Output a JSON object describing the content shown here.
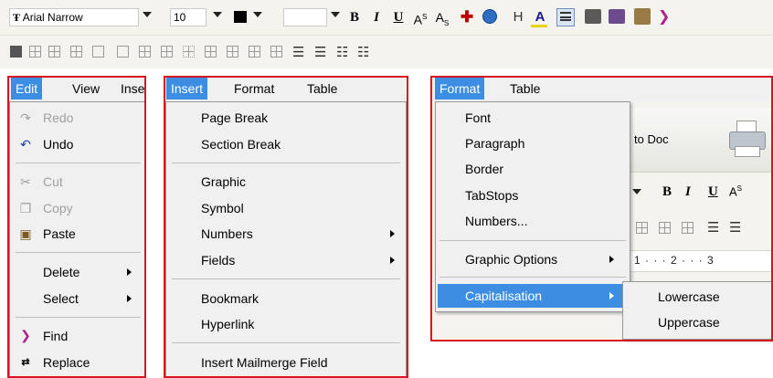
{
  "toolbar": {
    "font_name": "Arial Narrow",
    "font_size": "10",
    "format_buttons": [
      "B",
      "I",
      "U",
      "A",
      "A",
      "H",
      "A"
    ],
    "superscript_mark": "S",
    "subscript_mark": "S"
  },
  "panel_edit": {
    "menubar": [
      "Edit",
      "View",
      "Inse"
    ],
    "items": {
      "redo": "Redo",
      "undo": "Undo",
      "cut": "Cut",
      "copy": "Copy",
      "paste": "Paste",
      "delete": "Delete",
      "select": "Select",
      "find": "Find",
      "replace": "Replace"
    }
  },
  "panel_insert": {
    "menubar": [
      "Insert",
      "Format",
      "Table"
    ],
    "items": [
      "Page Break",
      "Section Break",
      "Graphic",
      "Symbol",
      "Numbers",
      "Fields",
      "Bookmark",
      "Hyperlink",
      "Insert Mailmerge Field"
    ]
  },
  "panel_format": {
    "menubar": [
      "Format",
      "Table"
    ],
    "items": [
      "Font",
      "Paragraph",
      "Border",
      "TabStops",
      "Numbers...",
      "Graphic Options",
      "Capitalisation"
    ],
    "submenu": [
      "Lowercase",
      "Uppercase"
    ],
    "background": {
      "to_doc": "to Doc",
      "format_buttons": [
        "B",
        "I",
        "U",
        "A"
      ],
      "ruler": "1 · · · 2 · · · 3"
    }
  },
  "colors": {
    "highlight": "#3d8ee2",
    "annotation_border": "#d8151c",
    "menu_background": "#f0f0f0"
  }
}
